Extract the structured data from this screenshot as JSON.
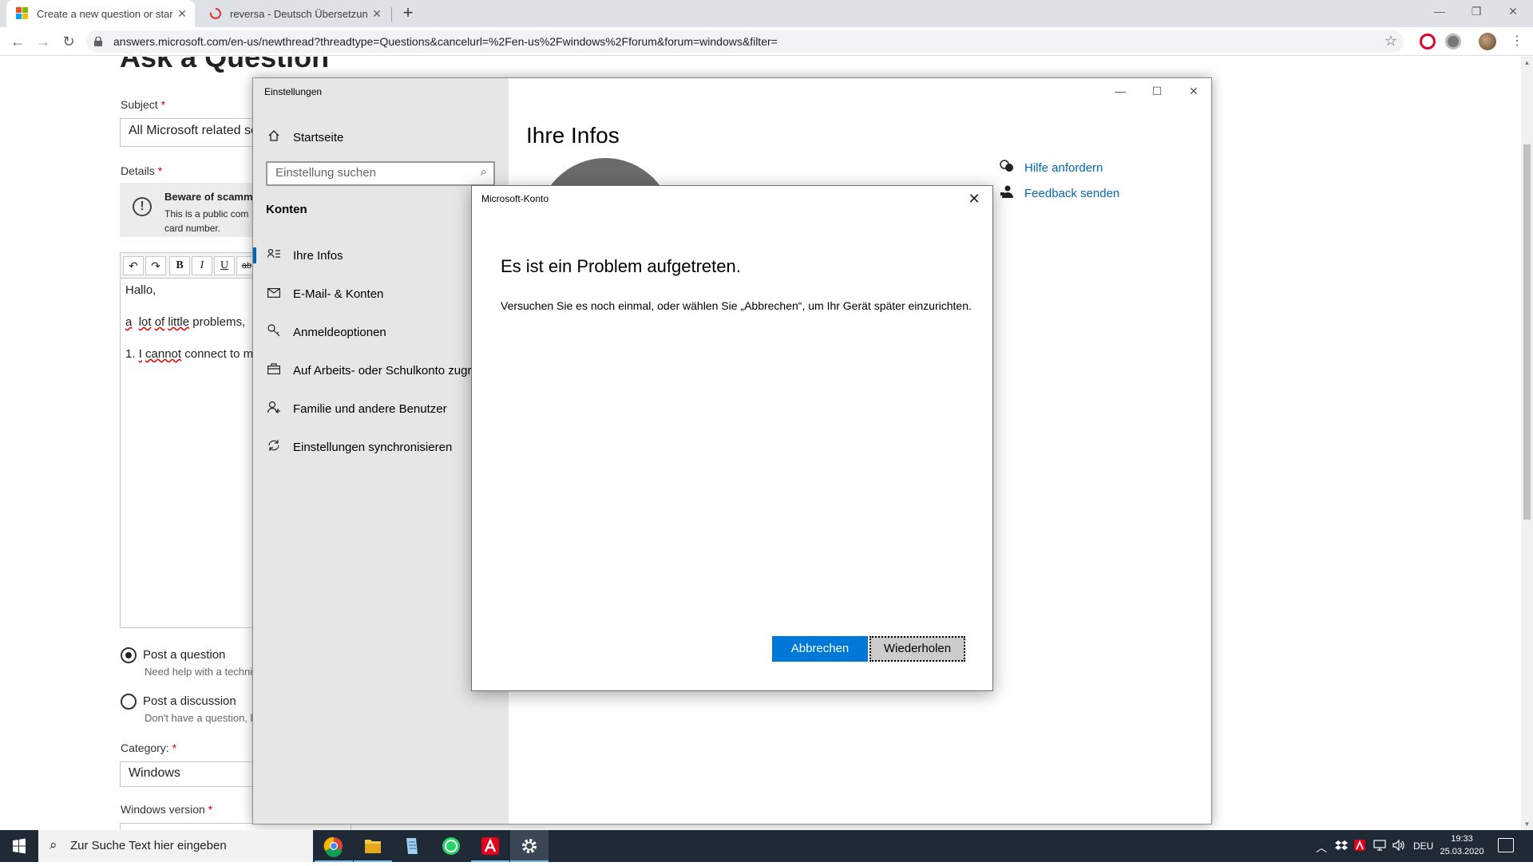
{
  "browser": {
    "tabs": [
      {
        "title": "Create a new question or start a",
        "active": true
      },
      {
        "title": "reversa - Deutsch Übersetzung -",
        "active": false
      }
    ],
    "new_tab": "+",
    "url": "answers.microsoft.com/en-us/newthread?threadtype=Questions&cancelurl=%2Fen-us%2Fwindows%2Fforum&forum=windows&filter=",
    "controls": {
      "minimize": "—",
      "restore": "❐",
      "close": "✕"
    }
  },
  "webpage": {
    "title": "Ask a Question",
    "subject_label": "Subject",
    "subject_value": "All Microsoft related se",
    "details_label": "Details",
    "required_mark": "*",
    "warning": {
      "title": "Beware of scamme",
      "line1": "This is a public com",
      "line2": "card number."
    },
    "editor": {
      "undo": "↶",
      "redo": "↷",
      "bold": "B",
      "italic": "I",
      "underline": "U",
      "strike": "ab",
      "line1": "Hallo,",
      "line2_a": "a",
      "line2_b": "lot",
      "line2_c": "of",
      "line2_d": "little",
      "line2_e": "problems,",
      "line3_a": "1.",
      "line3_b": "I",
      "line3_c": "cannot",
      "line3_d": "connect to m"
    },
    "post_question": {
      "label": "Post a question",
      "sub": "Need help with a techni",
      "selected": true
    },
    "post_discussion": {
      "label": "Post a discussion",
      "sub": "Don't have a question, b",
      "selected": false
    },
    "category_label": "Category:",
    "category_value": "Windows",
    "version_label": "Windows version"
  },
  "settings": {
    "window_title": "Einstellungen",
    "home": "Startseite",
    "search_placeholder": "Einstellung suchen",
    "section": "Konten",
    "nav": [
      {
        "label": "Ihre Infos",
        "icon": "person-card-icon"
      },
      {
        "label": "E-Mail- & Konten",
        "icon": "mail-icon"
      },
      {
        "label": "Anmeldeoptionen",
        "icon": "key-icon"
      },
      {
        "label": "Auf Arbeits- oder Schulkonto zugr",
        "icon": "briefcase-icon"
      },
      {
        "label": "Familie und andere Benutzer",
        "icon": "add-person-icon"
      },
      {
        "label": "Einstellungen synchronisieren",
        "icon": "sync-icon"
      }
    ],
    "page_title": "Ihre Infos",
    "help": "Hilfe anfordern",
    "feedback": "Feedback senden"
  },
  "dialog": {
    "title": "Microsoft-Konto",
    "heading": "Es ist ein Problem aufgetreten.",
    "message": "Versuchen Sie es noch einmal, oder wählen Sie „Abbrechen“, um Ihr Gerät später einzurichten.",
    "cancel": "Abbrechen",
    "retry": "Wiederholen"
  },
  "taskbar": {
    "search_placeholder": "Zur Suche Text hier eingeben",
    "language": "DEU",
    "time": "19:33",
    "date": "25.03.2020"
  },
  "colors": {
    "accent": "#0078d7",
    "link": "#0067b8",
    "taskbar": "#1f2a36",
    "sidebar": "#e6e6e6"
  }
}
